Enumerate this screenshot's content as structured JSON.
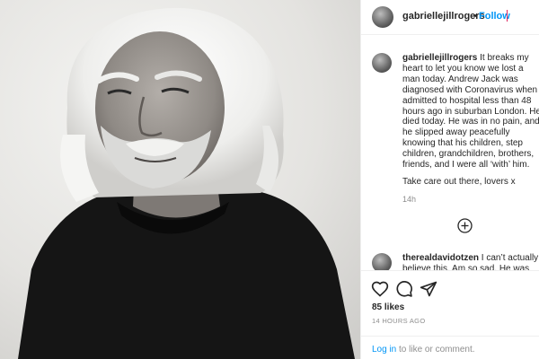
{
  "post": {
    "author": "gabriellejillrogers",
    "separator": "•",
    "follow_label": "Follow"
  },
  "comments": [
    {
      "username": "gabriellejillrogers",
      "text": " It breaks my heart to let you know we lost a man today. Andrew Jack was diagnosed with Coronavirus when admitted to hospital less than 48 hours ago in suburban London. He died today. He was in no pain, and he slipped away peacefully knowing that his children, step children, grandchildren, brothers, friends, and I were all ‘with’ him.",
      "text2": "Take care out there, lovers x",
      "time": "14h"
    },
    {
      "username": "therealdavidotzen",
      "text": " I can’t actually believe this. Am so sad. He was the"
    }
  ],
  "footer": {
    "likes": "85 likes",
    "date": "14 HOURS AGO",
    "login_link": "Log in",
    "login_rest": " to like or comment."
  },
  "icons": {
    "heart": "heart-icon",
    "comment": "comment-icon",
    "share": "share-icon",
    "load_more": "plus-circle-icon"
  },
  "colors": {
    "link_blue": "#0095f6",
    "muted": "#8e8e8e",
    "text": "#262626",
    "border": "#efefef"
  }
}
